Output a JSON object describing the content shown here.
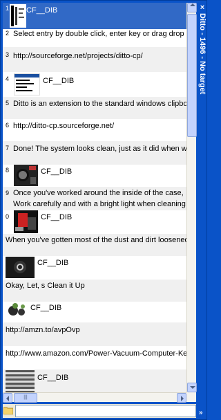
{
  "window": {
    "title": "Ditto - 1496 - No target"
  },
  "rows": [
    {
      "num": "1",
      "text": "CF__DIB",
      "kind": "dib"
    },
    {
      "num": "2",
      "text": "Select entry by double click, enter key or drag drop",
      "kind": "text"
    },
    {
      "num": "3",
      "text": "http://sourceforge.net/projects/ditto-cp/",
      "kind": "text"
    },
    {
      "num": "4",
      "text": "CF__DIB",
      "kind": "dib"
    },
    {
      "num": "5",
      "text": "Ditto is an extension to the standard windows clipbo",
      "kind": "text"
    },
    {
      "num": "6",
      "text": "http://ditto-cp.sourceforge.net/",
      "kind": "text"
    },
    {
      "num": "7",
      "text": "Done! The system looks clean, just as it did when w",
      "kind": "text"
    },
    {
      "num": "8",
      "text": "CF__DIB",
      "kind": "dib"
    },
    {
      "num": "9",
      "text": "Once you've worked around the inside of the case,",
      "text2": "Work carefully and with a bright light when cleaning",
      "kind": "text2"
    },
    {
      "num": "0",
      "text": "CF__DIB",
      "kind": "dib"
    },
    {
      "num": "",
      "text": "When you've gotten most of the dust and dirt loosened",
      "kind": "text"
    },
    {
      "num": "",
      "text": "CF__DIB",
      "kind": "dib"
    },
    {
      "num": "",
      "text": "Okay, Let‚ s Clean it Up",
      "kind": "text"
    },
    {
      "num": "",
      "text": "CF__DIB",
      "kind": "dib"
    },
    {
      "num": "",
      "text": "http://amzn.to/avpOvp",
      "kind": "text"
    },
    {
      "num": "",
      "text": "http://www.amazon.com/Power-Vacuum-Computer-Ke",
      "kind": "text"
    },
    {
      "num": "",
      "text": "CF__DIB",
      "kind": "dib"
    }
  ],
  "search": {
    "value": "",
    "placeholder": ""
  },
  "scrollbar": {
    "h_thumb_grip": "|||"
  },
  "icons": {
    "close": "close-icon",
    "folder": "folder-icon",
    "chevron": "chevron-icon"
  },
  "colors": {
    "titlebar": "#0a53c8",
    "selected": "#3169c6",
    "alt_row": "#f0f0f0"
  },
  "glyphs": {
    "close": "×",
    "chevron": "»"
  }
}
